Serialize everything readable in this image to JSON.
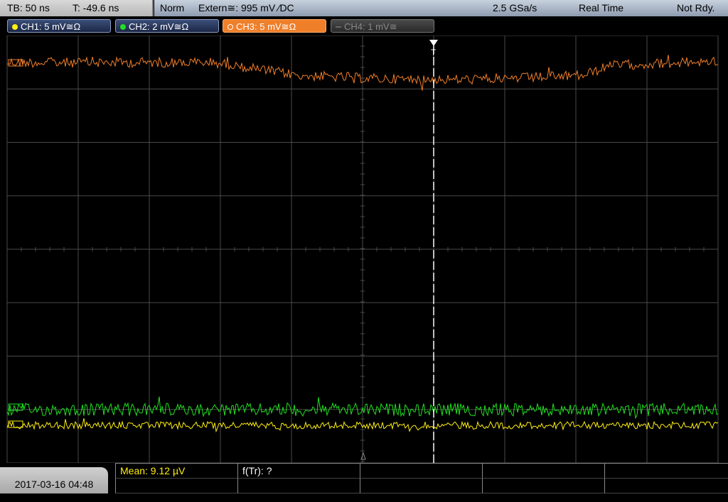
{
  "status": {
    "timebase": "TB: 50 ns",
    "trigger_time": "T: -49.6 ns",
    "mode": "Norm",
    "trigger_source": "Extern≅: 995 mV ∕DC",
    "sample_rate": "2.5 GSa/s",
    "acq_mode": "Real Time",
    "state": "Not Rdy."
  },
  "channels": [
    {
      "label": "CH1: 5 mV≅Ω",
      "color": "#ffef10",
      "active": true
    },
    {
      "label": "CH2: 2 mV≅Ω",
      "color": "#20e020",
      "active": true
    },
    {
      "label": "CH3: 5 mV≅Ω",
      "color": "#f07f2a",
      "active": true,
      "selected": true
    },
    {
      "label": "CH4: 1 mV≅",
      "color": "#888888",
      "active": false
    }
  ],
  "measurements": {
    "mean": "Mean: 9.12 µV",
    "freq": "f(Tr): ?"
  },
  "datetime": "2017-03-16 04:48",
  "colors": {
    "grid": "#4a4a4a",
    "ch1": "#ffef10",
    "ch2": "#20e020",
    "ch3": "#f07f2a",
    "trigger": "#ffffff"
  }
}
